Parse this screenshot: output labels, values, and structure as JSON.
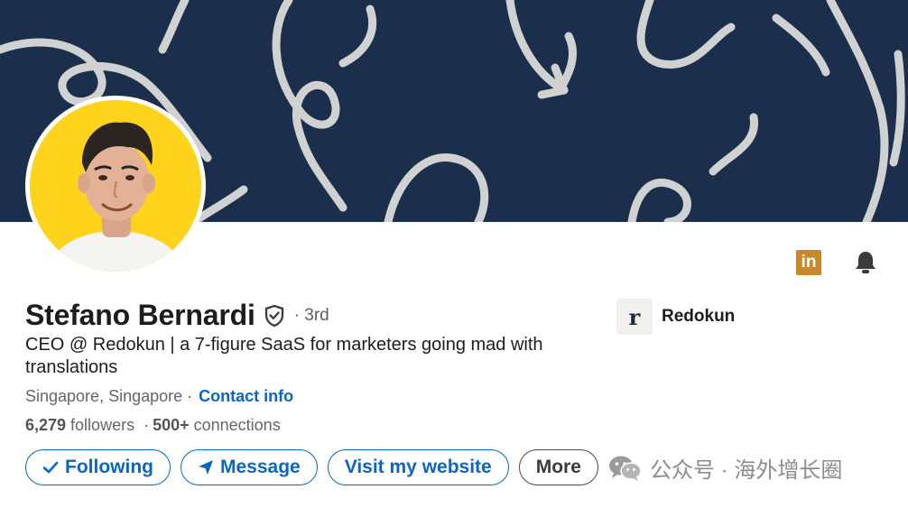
{
  "profile": {
    "name": "Stefano Bernardi",
    "degree": "· 3rd",
    "headline": "CEO @ Redokun | a 7-figure SaaS for marketers going mad with translations",
    "location": "Singapore, Singapore ·",
    "contact_label": "Contact info",
    "followers_count": "6,279",
    "followers_label": "followers",
    "connections_count": "500+",
    "connections_label": "connections"
  },
  "company": {
    "logo_letter": "r",
    "name": "Redokun"
  },
  "top_icons": {
    "linkedin_badge": "in"
  },
  "actions": {
    "following_label": "Following",
    "message_label": "Message",
    "website_label": "Visit my website",
    "more_label": "More"
  },
  "watermark": {
    "text": "公众号 · 海外增长圈"
  },
  "colors": {
    "banner_bg": "#1b2e4b",
    "accent": "#0a66c2",
    "avatar_bg": "#ffd21c",
    "linkedin_badge": "#c7882a"
  }
}
